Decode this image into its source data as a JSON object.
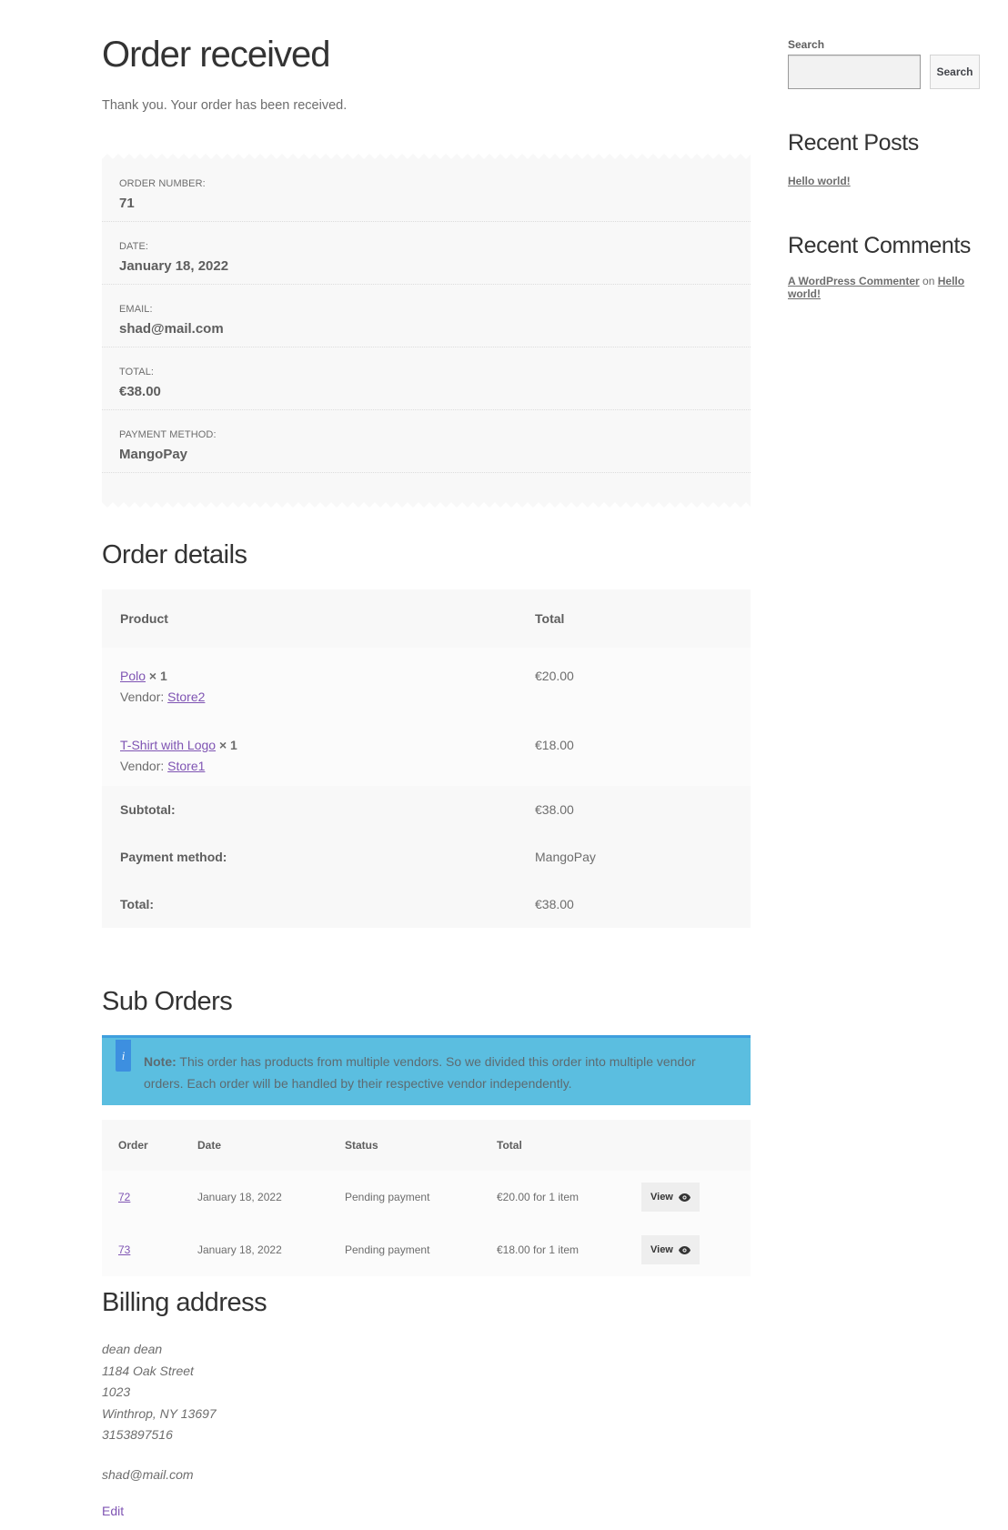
{
  "page": {
    "title": "Order received",
    "thank_you": "Thank you. Your order has been received."
  },
  "overview": [
    {
      "label": "Order number:",
      "value": "71"
    },
    {
      "label": "Date:",
      "value": "January 18, 2022"
    },
    {
      "label": "Email:",
      "value": "shad@mail.com"
    },
    {
      "label": "Total:",
      "value": "€38.00"
    },
    {
      "label": "Payment method:",
      "value": "MangoPay"
    }
  ],
  "order_details": {
    "title": "Order details",
    "headers": {
      "product": "Product",
      "total": "Total"
    },
    "items": [
      {
        "product": "Polo",
        "qty": "× 1",
        "vendor_label": "Vendor:",
        "vendor": "Store2",
        "total": "€20.00"
      },
      {
        "product": "T-Shirt with Logo",
        "qty": "× 1",
        "vendor_label": "Vendor:",
        "vendor": "Store1",
        "total": "€18.00"
      }
    ],
    "totals": [
      {
        "label": "Subtotal:",
        "value": "€38.00"
      },
      {
        "label": "Payment method:",
        "value": "MangoPay"
      },
      {
        "label": "Total:",
        "value": "€38.00"
      }
    ]
  },
  "sub_orders": {
    "title": "Sub Orders",
    "note_icon": "info-icon",
    "note_label": "Note:",
    "note_text": " This order has products from multiple vendors. So we divided this order into multiple vendor orders. Each order will be handled by their respective vendor independently.",
    "headers": {
      "order": "Order",
      "date": "Date",
      "status": "Status",
      "total": "Total"
    },
    "rows": [
      {
        "order": "72",
        "date": "January 18, 2022",
        "status": "Pending payment",
        "total": "€20.00 for 1 item",
        "action": "View"
      },
      {
        "order": "73",
        "date": "January 18, 2022",
        "status": "Pending payment",
        "total": "€18.00 for 1 item",
        "action": "View"
      }
    ],
    "action_icon": "eye-icon"
  },
  "billing": {
    "title": "Billing address",
    "name": "dean dean",
    "address1": "1184 Oak Street",
    "address2": "1023",
    "city_line": "Winthrop, NY 13697",
    "phone": "3153897516",
    "email": "shad@mail.com",
    "edit_label": "Edit"
  },
  "sidebar": {
    "search_label": "Search",
    "search_value": "",
    "search_button": "Search",
    "recent_posts_title": "Recent Posts",
    "recent_posts": [
      "Hello world!"
    ],
    "recent_comments_title": "Recent Comments",
    "comment_author": "A WordPress Commenter",
    "comment_on": "on",
    "comment_post": "Hello world!"
  },
  "colors": {
    "link": "#7f54b3",
    "note_background": "#5bbee0",
    "note_border": "#3f9fde",
    "panel_background": "#f8f8f8"
  }
}
